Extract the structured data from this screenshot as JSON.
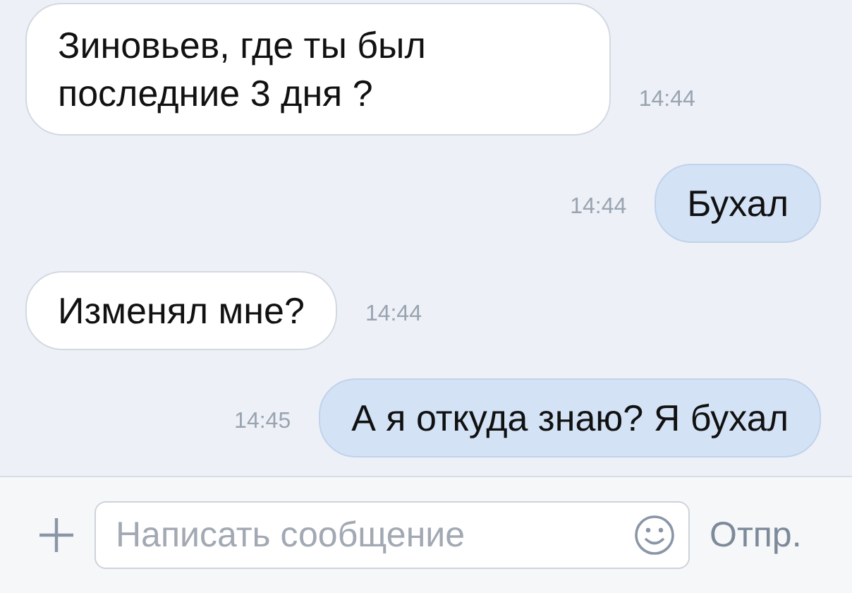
{
  "messages": [
    {
      "kind": "incoming",
      "text": "Зиновьев, где ты был\nпоследние 3 дня ?",
      "time": "14:44"
    },
    {
      "kind": "outgoing",
      "text": "Бухал",
      "time": "14:44"
    },
    {
      "kind": "incoming",
      "text": "Изменял мне?",
      "time": "14:44"
    },
    {
      "kind": "outgoing",
      "text": "А я откуда знаю? Я бухал",
      "time": "14:45"
    }
  ],
  "composer": {
    "placeholder": "Написать сообщение",
    "send": "Отпр."
  }
}
